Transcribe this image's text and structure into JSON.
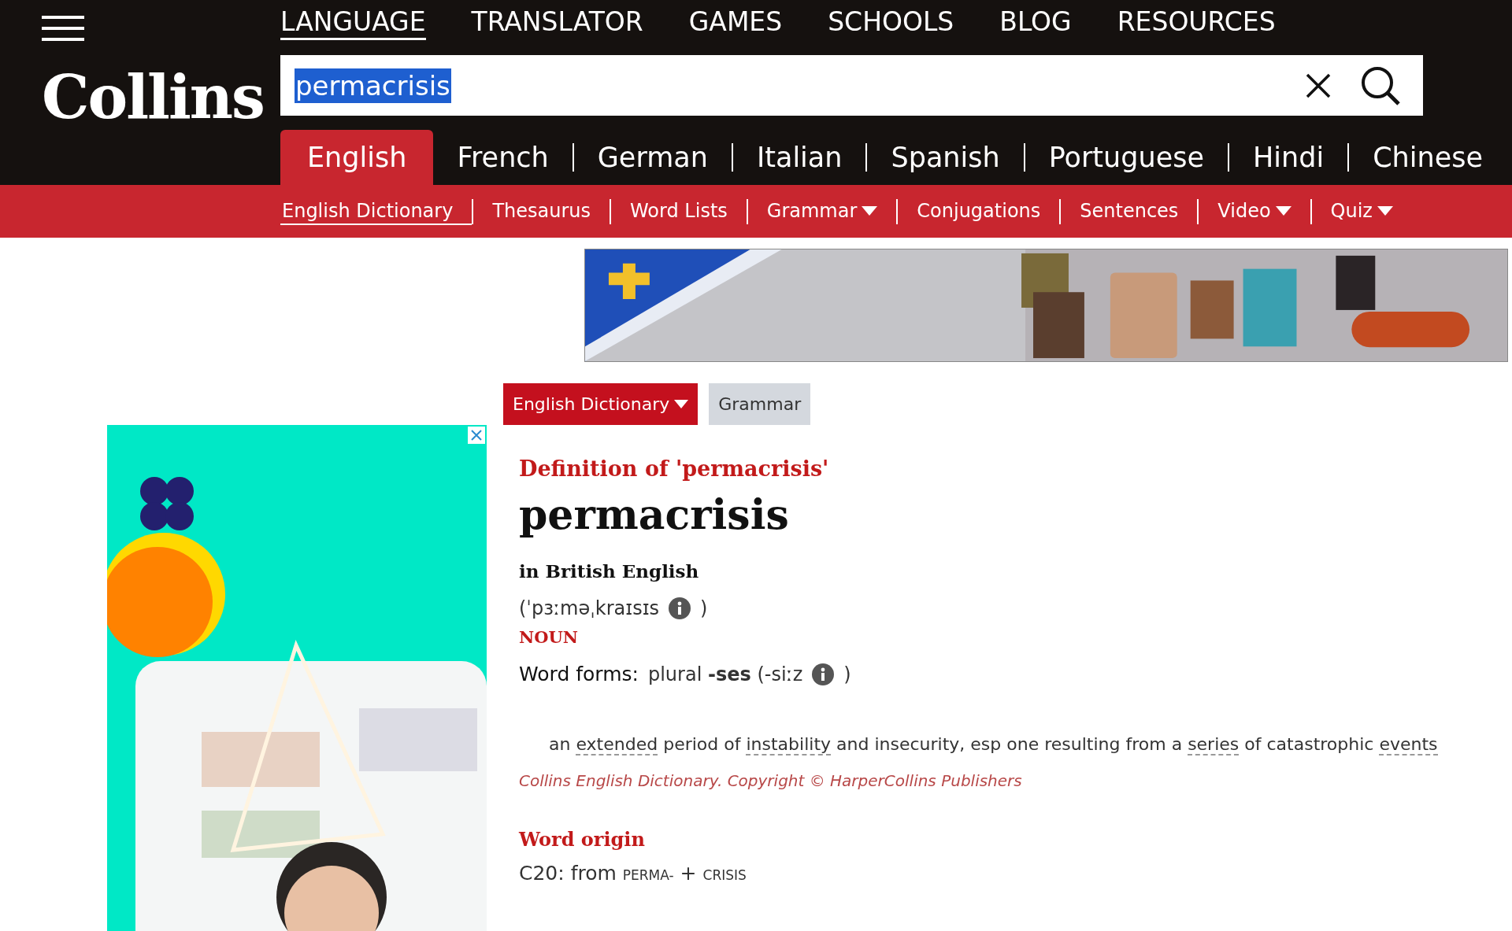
{
  "top_nav": [
    {
      "label": "LANGUAGE",
      "selected": true
    },
    {
      "label": "TRANSLATOR",
      "selected": false
    },
    {
      "label": "GAMES",
      "selected": false
    },
    {
      "label": "SCHOOLS",
      "selected": false
    },
    {
      "label": "BLOG",
      "selected": false
    },
    {
      "label": "RESOURCES",
      "selected": false
    }
  ],
  "logo": "Collins",
  "search": {
    "value": "permacrisis",
    "text_selected": true
  },
  "language_tabs": [
    {
      "label": "English",
      "selected": true
    },
    {
      "label": "French",
      "selected": false
    },
    {
      "label": "German",
      "selected": false
    },
    {
      "label": "Italian",
      "selected": false
    },
    {
      "label": "Spanish",
      "selected": false
    },
    {
      "label": "Portuguese",
      "selected": false
    },
    {
      "label": "Hindi",
      "selected": false
    },
    {
      "label": "Chinese",
      "selected": false
    }
  ],
  "sub_nav": [
    {
      "label": "English Dictionary",
      "selected": true,
      "dropdown": false
    },
    {
      "label": "Thesaurus",
      "selected": false,
      "dropdown": false
    },
    {
      "label": "Word Lists",
      "selected": false,
      "dropdown": false
    },
    {
      "label": "Grammar",
      "selected": false,
      "dropdown": true
    },
    {
      "label": "Conjugations",
      "selected": false,
      "dropdown": false
    },
    {
      "label": "Sentences",
      "selected": false,
      "dropdown": false
    },
    {
      "label": "Video",
      "selected": false,
      "dropdown": true
    },
    {
      "label": "Quiz",
      "selected": false,
      "dropdown": true
    }
  ],
  "dictionary_switch": [
    {
      "label": "English Dictionary",
      "selected": true,
      "dropdown": true
    },
    {
      "label": "Grammar",
      "selected": false,
      "dropdown": false
    }
  ],
  "entry": {
    "heading": "Definition of 'permacrisis'",
    "headword": "permacrisis",
    "variety": "in British English",
    "pronunciation": {
      "open": "(",
      "ipa": "ˈpɜːməˌkraɪsɪs",
      "close": ")"
    },
    "part_of_speech": "NOUN",
    "word_forms": {
      "label": "Word forms:",
      "text": "plural **-ses** (-siːz",
      "close": ")"
    },
    "definition": [
      {
        "text": "an",
        "link": false
      },
      {
        "text": "extended",
        "link": true
      },
      {
        "text": "period of",
        "link": false
      },
      {
        "text": "instability",
        "link": true
      },
      {
        "text": "and insecurity, esp one resulting from a",
        "link": false
      },
      {
        "text": "series",
        "link": true
      },
      {
        "text": "of catastrophic",
        "link": false
      },
      {
        "text": "events",
        "link": true
      }
    ],
    "copyright": "Collins English Dictionary. Copyright © HarperCollins Publishers",
    "word_origin": {
      "heading": "Word origin",
      "text": "C20: from",
      "parts": [
        {
          "text": "PERMA-",
          "kind": "reference"
        },
        {
          "text": "+",
          "kind": "plain"
        },
        {
          "text": "CRISIS",
          "kind": "reference"
        }
      ]
    }
  }
}
